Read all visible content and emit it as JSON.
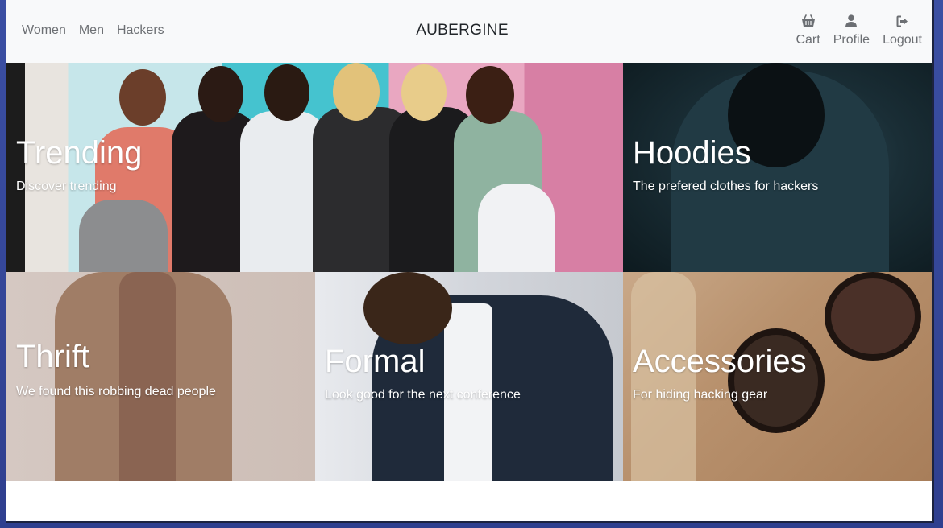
{
  "navbar": {
    "links": [
      "Women",
      "Men",
      "Hackers"
    ],
    "brand": "AUBERGINE",
    "actions": [
      {
        "label": "Cart",
        "icon": "basket-icon"
      },
      {
        "label": "Profile",
        "icon": "user-icon"
      },
      {
        "label": "Logout",
        "icon": "logout-icon"
      }
    ]
  },
  "tiles": [
    {
      "title": "Trending",
      "subtitle": "Discover trending"
    },
    {
      "title": "Hoodies",
      "subtitle": "The prefered clothes for hackers"
    },
    {
      "title": "Thrift",
      "subtitle": "We found this robbing dead people"
    },
    {
      "title": "Formal",
      "subtitle": "Look good for the next conference"
    },
    {
      "title": "Accessories",
      "subtitle": "For hiding hacking gear"
    }
  ],
  "colors": {
    "navbar_bg": "#f8f9fa",
    "nav_text": "#6c6f73",
    "brand_text": "#212529",
    "desktop_bg": "#3b4fa3"
  }
}
